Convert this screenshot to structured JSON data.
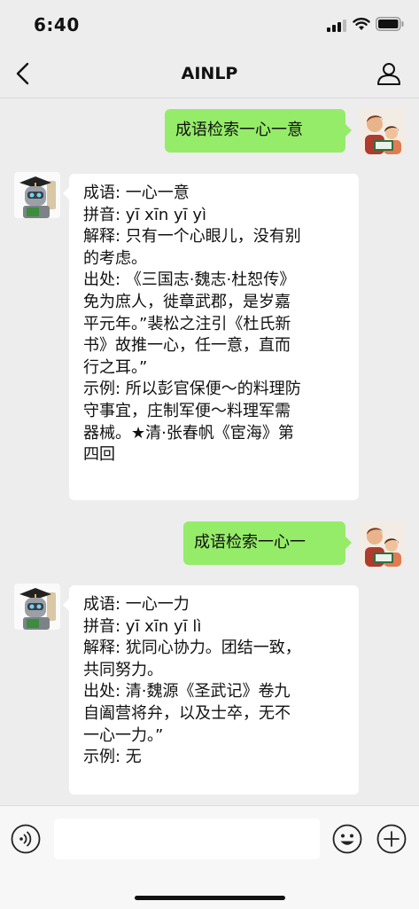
{
  "status_bar": {
    "time": "6:40"
  },
  "header": {
    "title": "AINLP"
  },
  "messages": [
    {
      "from": "user",
      "text": "成语检索一心一意"
    },
    {
      "from": "bot",
      "lines": [
        "成语: 一心一意",
        "拼音: yī xīn yī yì",
        "解释: 只有一个心眼儿，没有别",
        "的考虑。",
        "出处: 《三国志·魏志·杜恕传》",
        "免为庶人，徙章武郡，是岁嘉",
        "平元年。”裴松之注引《杜氏新",
        "书》故推一心，任一意，直而",
        "行之耳。”",
        "示例: 所以彭官保便～的料理防",
        "守事宜，庄制军便～料理军需",
        "器械。★清·张春帆《宦海》第",
        "四回"
      ]
    },
    {
      "from": "user",
      "text": "成语检索一心一"
    },
    {
      "from": "bot",
      "lines": [
        "成语: 一心一力",
        "拼音: yī xīn yī lì",
        "解释: 犹同心协力。团结一致，",
        "共同努力。",
        "出处: 清·魏源《圣武记》卷九",
        "自阖营将弁，以及士卒，无不",
        "一心一力。”",
        "示例: 无"
      ]
    }
  ],
  "input": {
    "placeholder": "",
    "value": ""
  },
  "icons": {
    "back": "chevron-left-icon",
    "profile": "person-icon",
    "voice": "voice-icon",
    "emoji": "emoji-icon",
    "more": "plus-icon"
  },
  "colors": {
    "user_bubble": "#95ec69",
    "bot_bubble": "#ffffff",
    "background": "#ededed"
  }
}
